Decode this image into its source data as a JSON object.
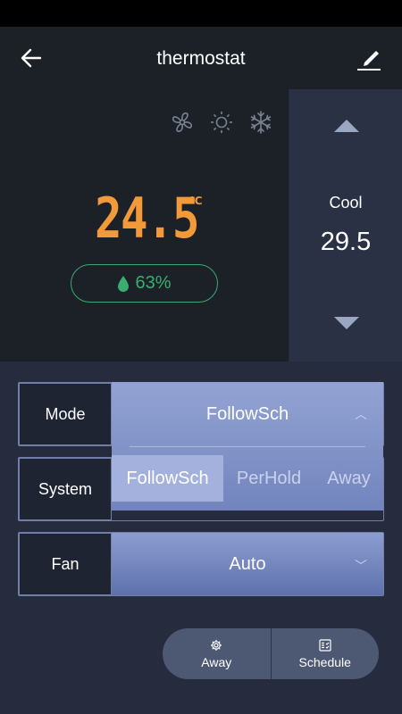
{
  "header": {
    "title": "thermostat"
  },
  "display": {
    "mode_icons": [
      "fan-icon",
      "sun-icon",
      "snowflake-icon"
    ],
    "current_temp": "24.5",
    "temp_unit": "℃",
    "humidity": "63%"
  },
  "setpoint_panel": {
    "mode": "Cool",
    "value": "29.5"
  },
  "controls": {
    "mode": {
      "label": "Mode",
      "value": "FollowSch",
      "options": [
        "FollowSch",
        "PerHold",
        "Away"
      ]
    },
    "system": {
      "label": "System"
    },
    "fan": {
      "label": "Fan",
      "value": "Auto"
    }
  },
  "actions": {
    "away": "Away",
    "schedule": "Schedule"
  },
  "colors": {
    "accent_temp": "#f2993a",
    "humidity": "#3aae6f",
    "panel": "#1c2128",
    "control_gradient": "#7284bd"
  }
}
